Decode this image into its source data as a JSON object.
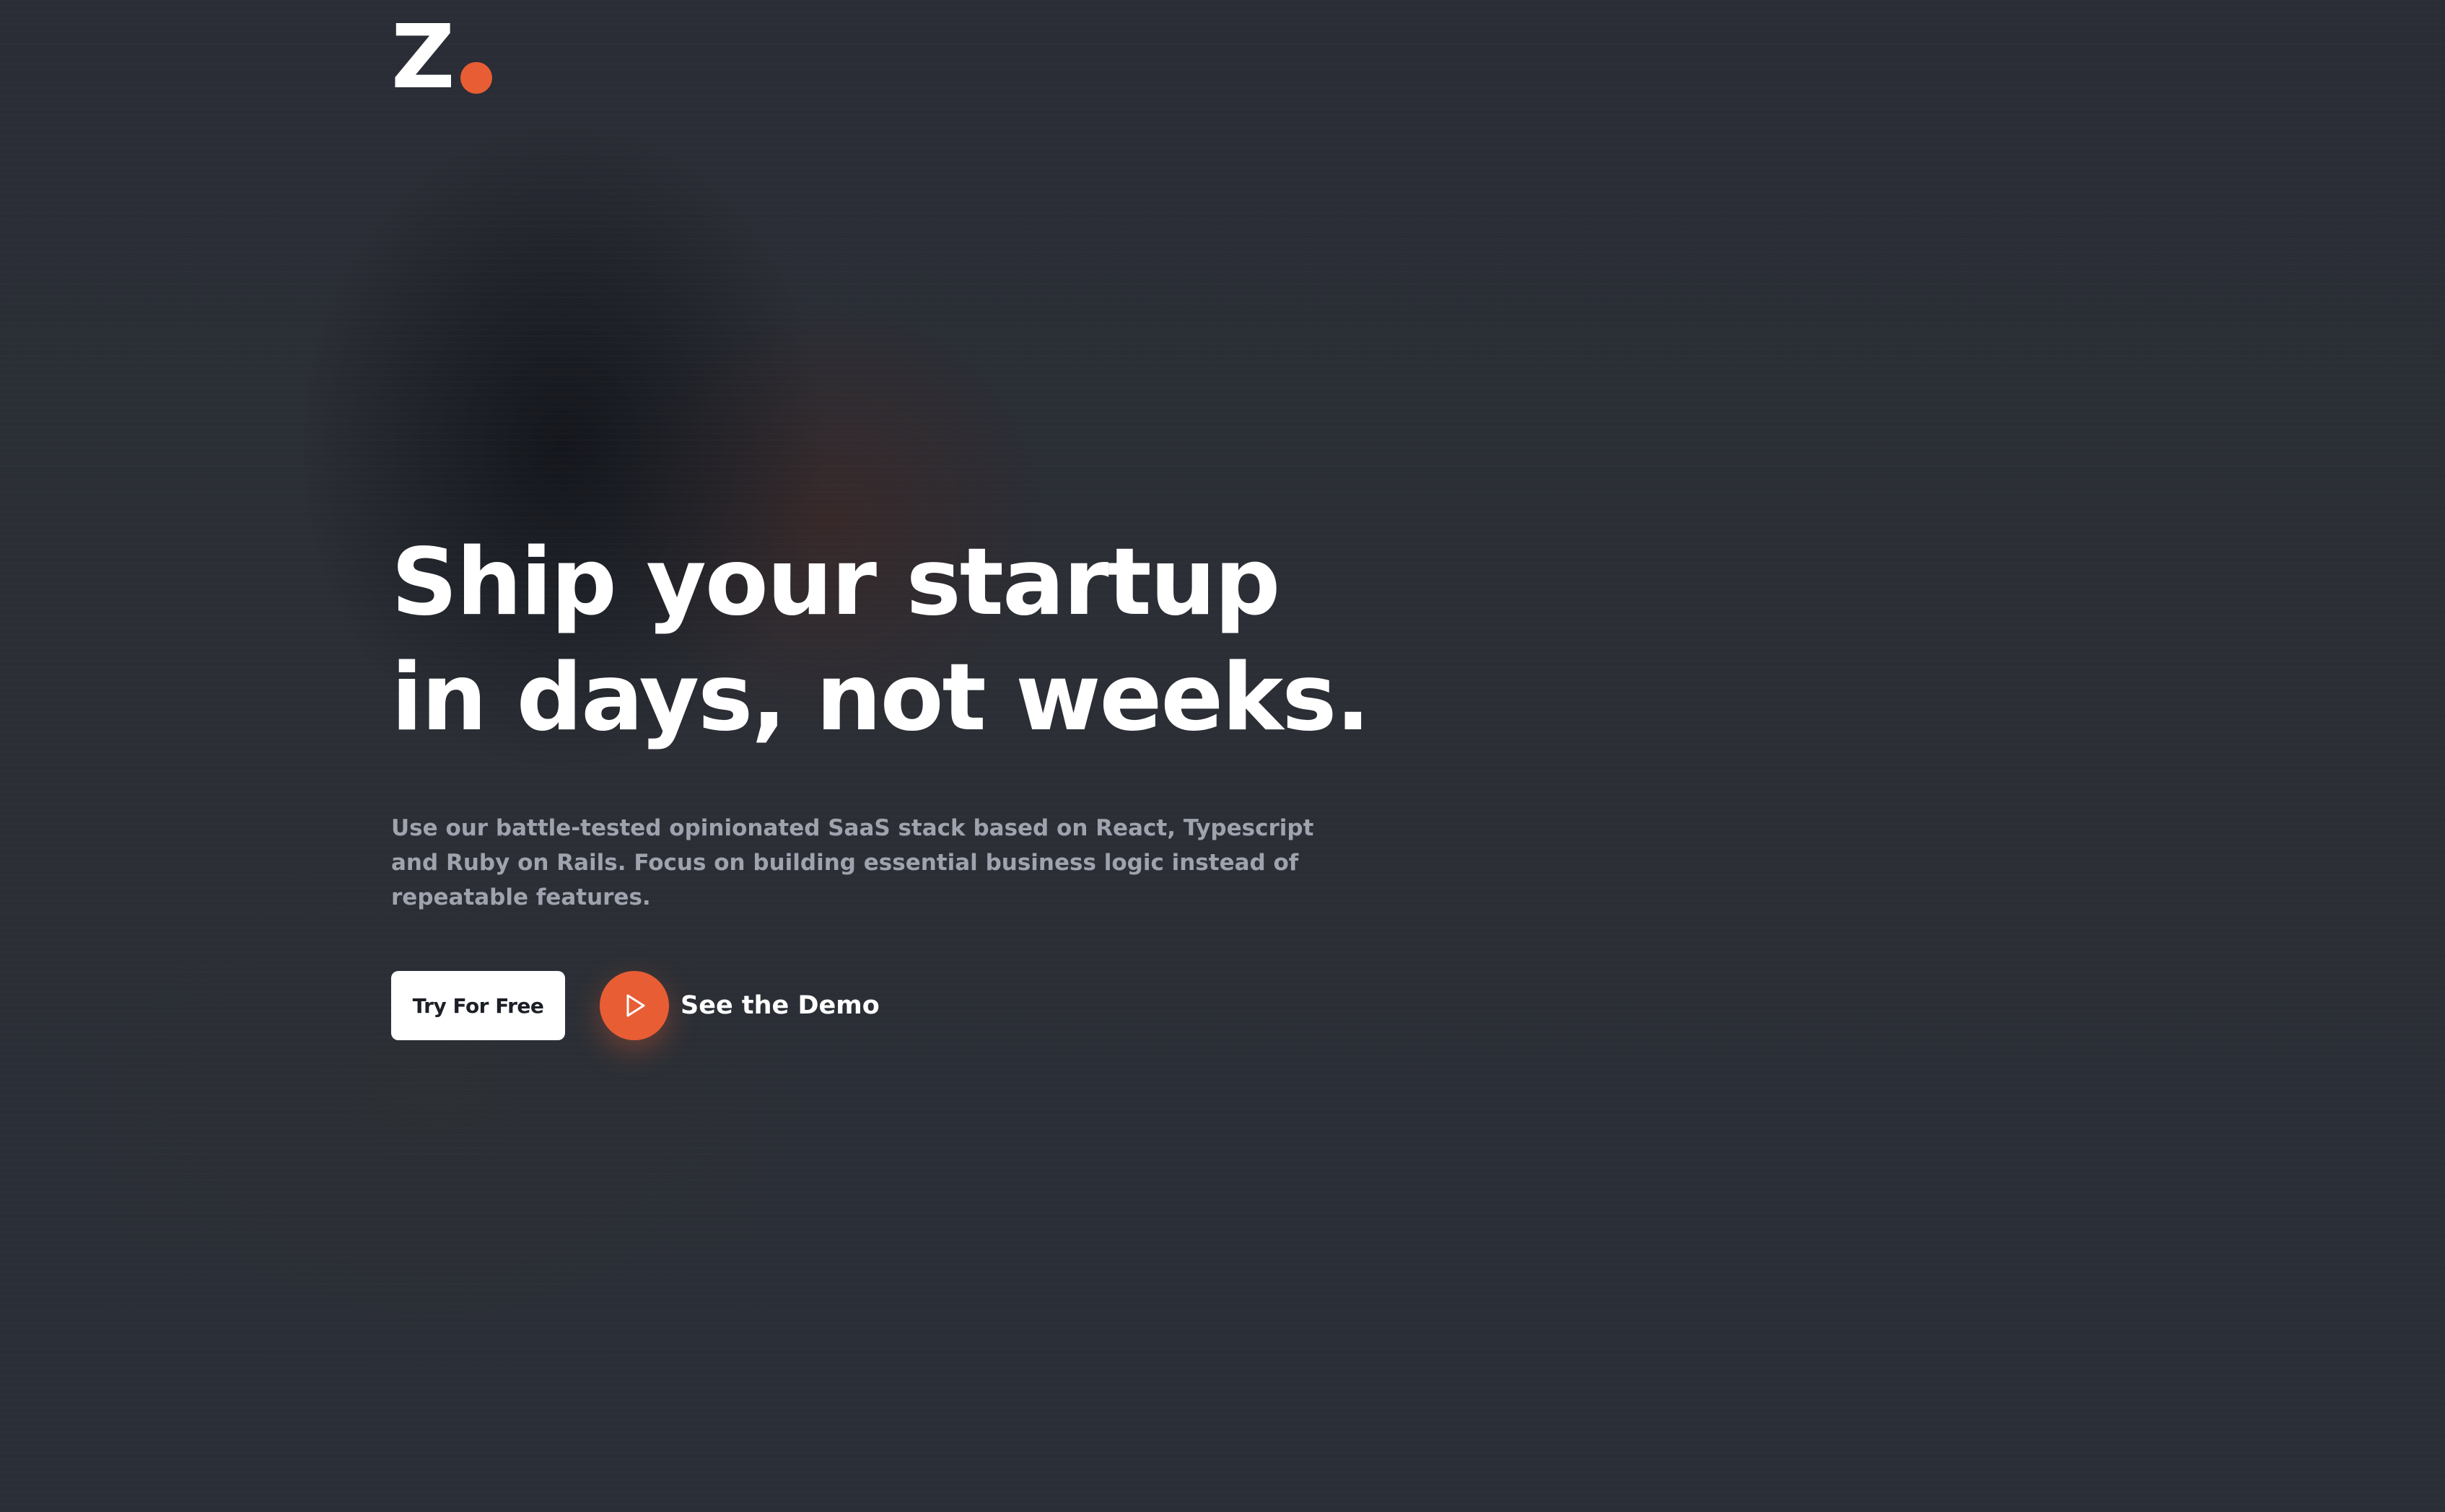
{
  "brand": {
    "logo_letter": "Z",
    "accent_color": "#e85d34"
  },
  "hero": {
    "headline_line1": "Ship your startup",
    "headline_line2": "in days, not weeks.",
    "subtext": "Use our battle-tested opinionated SaaS stack based on React, Typescript and Ruby on Rails. Focus on building essential business logic instead of repeatable features.",
    "primary_cta": "Try For Free",
    "secondary_cta": "See the Demo",
    "secondary_cta_icon": "play-icon"
  },
  "colors": {
    "background": "#2b2e35",
    "headline": "#ffffff",
    "subtext": "#9ea3ad",
    "primary_button_bg": "#ffffff",
    "primary_button_text": "#1c1f26"
  }
}
